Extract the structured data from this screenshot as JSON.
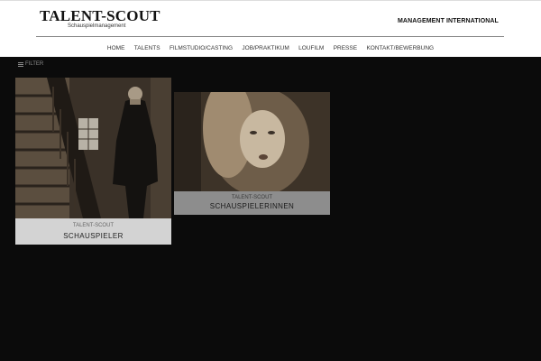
{
  "brand": {
    "title": "TALENT-SCOUT",
    "subtitle": "Schauspielmanagement",
    "tagline": "MANAGEMENT INTERNATIONAL"
  },
  "nav": {
    "items": [
      "HOME",
      "TALENTS",
      "FILMSTUDIO/CASTING",
      "JOB/PRAKTIKUM",
      "LOUFILM",
      "PRESSE",
      "KONTAKT/BEWERBUNG"
    ]
  },
  "filter": {
    "label": "FILTER",
    "icon": "list-icon"
  },
  "cards": [
    {
      "subtitle": "TALENT-SCOUT",
      "title": "SCHAUSPIELER"
    },
    {
      "subtitle": "TALENT-SCOUT",
      "title": "SCHAUSPIELERINNEN"
    }
  ],
  "colors": {
    "background": "#0b0b0b",
    "header": "#ffffff",
    "caption_light": "#d3d3d3",
    "caption_dark": "#8d8d8d"
  }
}
